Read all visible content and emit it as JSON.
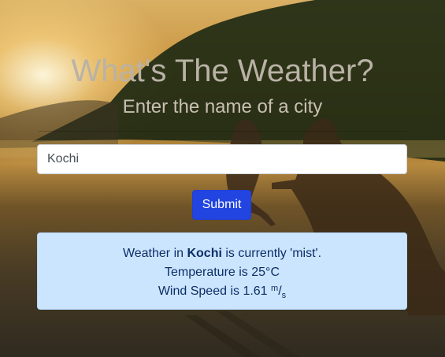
{
  "page": {
    "title": "What's The Weather?",
    "subtitle": "Enter the name of a city",
    "background": "beach-sunset-kangaroos"
  },
  "form": {
    "city_value": "Kochi",
    "submit_label": "Submit"
  },
  "result": {
    "prefix": "Weather in ",
    "city": "Kochi",
    "condition_text": " is currently 'mist'.",
    "temperature_text": "Temperature is 25°C",
    "wind_prefix": "Wind Speed is 1.61 ",
    "wind_unit_num": "m",
    "wind_unit_sep": "/",
    "wind_unit_den": "s"
  },
  "colors": {
    "title": "#b9b2a6",
    "submit": "#2244e0",
    "alert_bg": "#cce5ff",
    "alert_text": "#0c2e66"
  }
}
